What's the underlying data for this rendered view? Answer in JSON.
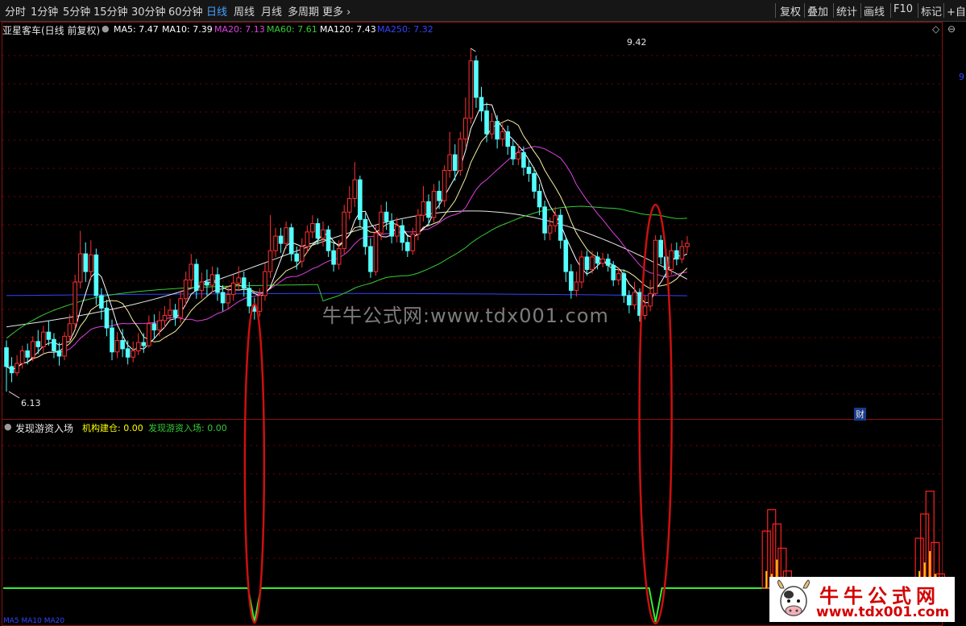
{
  "toolbar": {
    "periods": [
      "分时",
      "1分钟",
      "5分钟",
      "15分钟",
      "30分钟",
      "60分钟",
      "日线",
      "周线",
      "月线",
      "多周期",
      "更多 ›"
    ],
    "active": "日线",
    "right": [
      "复权",
      "叠加",
      "统计",
      "画线",
      "F10",
      "标记",
      "+自选"
    ]
  },
  "main": {
    "stock": "亚星客车(日线 前复权)",
    "ma": [
      {
        "label": "MA5: 7.47",
        "color": "#ffffff"
      },
      {
        "label": "MA10: 7.39",
        "color": "#ffffff"
      },
      {
        "label": "MA20: 7.13",
        "color": "#e040e0"
      },
      {
        "label": "MA60: 7.61",
        "color": "#33cc33"
      },
      {
        "label": "MA120: 7.43",
        "color": "#ffffff"
      },
      {
        "label": "MA250: 7.32",
        "color": "#3344ff"
      }
    ],
    "high_label": "9.42",
    "low_label": "6.13",
    "right_edge_label": "9",
    "fin_badge": "财",
    "watermark": "牛牛公式网:www.tdx001.com"
  },
  "sub": {
    "name": "发现游资入场",
    "values": [
      {
        "label": "机构建仓: 0.00",
        "color": "#ffff00"
      },
      {
        "label": "发现游资入场: 0.00",
        "color": "#33cc33"
      }
    ],
    "bottom_info": "MA5 MA10 MA20"
  },
  "brand": {
    "title": "牛牛公式网",
    "url": "www.tdx001.com"
  },
  "colors": {
    "up": "#ff3030",
    "down": "#54ffff",
    "ma5": "#ffffff",
    "ma10": "#f5f0a0",
    "ma20": "#e040e0",
    "ma60": "#33cc33",
    "ma120": "#e6e6e6",
    "ma250": "#3344ff",
    "grid": "#7a0000",
    "signal": "#33ee33",
    "bar_red": "#ff2020",
    "bar_yellow": "#ffd000"
  },
  "chart_data": {
    "type": "candlestick",
    "title": "亚星客车(日线 前复权)",
    "price_range": [
      6.13,
      9.42
    ],
    "candles": [
      [
        6.55,
        6.37,
        6.62,
        6.13
      ],
      [
        6.37,
        6.31,
        6.46,
        6.22
      ],
      [
        6.31,
        6.4,
        6.48,
        6.28
      ],
      [
        6.4,
        6.52,
        6.57,
        6.35
      ],
      [
        6.52,
        6.46,
        6.59,
        6.39
      ],
      [
        6.46,
        6.61,
        6.66,
        6.42
      ],
      [
        6.61,
        6.56,
        6.72,
        6.49
      ],
      [
        6.56,
        6.7,
        6.76,
        6.5
      ],
      [
        6.7,
        6.63,
        6.81,
        6.57
      ],
      [
        6.63,
        6.52,
        6.69,
        6.45
      ],
      [
        6.52,
        6.47,
        6.6,
        6.38
      ],
      [
        6.47,
        6.66,
        6.7,
        6.43
      ],
      [
        6.66,
        6.78,
        6.87,
        6.6
      ],
      [
        6.78,
        7.18,
        7.25,
        6.73
      ],
      [
        7.18,
        7.45,
        7.67,
        7.12
      ],
      [
        7.45,
        7.28,
        7.56,
        7.18
      ],
      [
        7.28,
        7.44,
        7.58,
        7.2
      ],
      [
        7.44,
        7.05,
        7.5,
        6.96
      ],
      [
        7.05,
        6.93,
        7.12,
        6.82
      ],
      [
        6.93,
        6.74,
        7.01,
        6.66
      ],
      [
        6.74,
        6.51,
        6.82,
        6.43
      ],
      [
        6.51,
        6.62,
        6.7,
        6.45
      ],
      [
        6.62,
        6.54,
        6.73,
        6.46
      ],
      [
        6.54,
        6.46,
        6.62,
        6.39
      ],
      [
        6.46,
        6.52,
        6.61,
        6.41
      ],
      [
        6.52,
        6.6,
        6.69,
        6.48
      ],
      [
        6.6,
        6.57,
        6.69,
        6.5
      ],
      [
        6.57,
        6.78,
        6.86,
        6.55
      ],
      [
        6.78,
        6.72,
        6.87,
        6.64
      ],
      [
        6.72,
        6.81,
        6.9,
        6.66
      ],
      [
        6.81,
        6.86,
        6.95,
        6.74
      ],
      [
        6.86,
        6.91,
        7.02,
        6.8
      ],
      [
        6.91,
        6.84,
        6.97,
        6.76
      ],
      [
        6.84,
        7.02,
        7.1,
        6.79
      ],
      [
        7.02,
        7.2,
        7.28,
        6.96
      ],
      [
        7.2,
        7.35,
        7.45,
        7.12
      ],
      [
        7.35,
        7.1,
        7.4,
        7.02
      ],
      [
        7.1,
        7.18,
        7.27,
        7.02
      ],
      [
        7.18,
        7.15,
        7.3,
        7.05
      ],
      [
        7.15,
        7.25,
        7.33,
        7.08
      ],
      [
        7.25,
        7.08,
        7.32,
        7.0
      ],
      [
        7.08,
        6.98,
        7.15,
        6.9
      ],
      [
        6.98,
        7.06,
        7.14,
        6.92
      ],
      [
        7.06,
        7.17,
        7.25,
        7.0
      ],
      [
        7.17,
        7.22,
        7.33,
        7.1
      ],
      [
        7.22,
        7.12,
        7.28,
        7.04
      ],
      [
        7.12,
        6.95,
        7.18,
        6.88
      ],
      [
        6.95,
        6.9,
        7.03,
        6.82
      ],
      [
        6.9,
        7.05,
        7.12,
        6.85
      ],
      [
        7.05,
        7.28,
        7.36,
        7.0
      ],
      [
        7.28,
        7.48,
        7.82,
        7.22
      ],
      [
        7.48,
        7.62,
        7.7,
        7.42
      ],
      [
        7.62,
        7.55,
        7.7,
        7.46
      ],
      [
        7.55,
        7.7,
        7.76,
        7.5
      ],
      [
        7.7,
        7.45,
        7.74,
        7.38
      ],
      [
        7.45,
        7.38,
        7.52,
        7.3
      ],
      [
        7.38,
        7.52,
        7.6,
        7.32
      ],
      [
        7.52,
        7.66,
        7.72,
        7.46
      ],
      [
        7.66,
        7.74,
        7.82,
        7.6
      ],
      [
        7.74,
        7.6,
        7.79,
        7.54
      ],
      [
        7.6,
        7.68,
        7.76,
        7.52
      ],
      [
        7.68,
        7.48,
        7.72,
        7.42
      ],
      [
        7.48,
        7.35,
        7.56,
        7.28
      ],
      [
        7.35,
        7.5,
        7.58,
        7.3
      ],
      [
        7.5,
        7.85,
        7.92,
        7.45
      ],
      [
        7.85,
        7.98,
        8.1,
        7.78
      ],
      [
        7.98,
        8.16,
        8.33,
        7.9
      ],
      [
        8.16,
        7.78,
        8.2,
        7.7
      ],
      [
        7.78,
        7.52,
        7.84,
        7.44
      ],
      [
        7.52,
        7.28,
        7.6,
        7.22
      ],
      [
        7.28,
        7.65,
        7.72,
        7.24
      ],
      [
        7.65,
        7.85,
        7.92,
        7.58
      ],
      [
        7.85,
        7.76,
        7.95,
        7.68
      ],
      [
        7.76,
        7.62,
        7.84,
        7.55
      ],
      [
        7.62,
        7.72,
        7.8,
        7.56
      ],
      [
        7.72,
        7.56,
        7.78,
        7.48
      ],
      [
        7.56,
        7.48,
        7.62,
        7.42
      ],
      [
        7.48,
        7.64,
        7.7,
        7.44
      ],
      [
        7.64,
        7.82,
        7.88,
        7.58
      ],
      [
        7.82,
        7.95,
        8.1,
        7.76
      ],
      [
        7.95,
        7.8,
        8.02,
        7.72
      ],
      [
        7.8,
        8.05,
        8.12,
        7.75
      ],
      [
        8.05,
        7.96,
        8.15,
        7.88
      ],
      [
        7.96,
        8.25,
        8.3,
        7.9
      ],
      [
        8.25,
        8.4,
        8.62,
        8.18
      ],
      [
        8.4,
        8.25,
        8.5,
        8.15
      ],
      [
        8.25,
        8.55,
        8.62,
        8.2
      ],
      [
        8.55,
        8.75,
        8.95,
        8.48
      ],
      [
        8.75,
        9.3,
        9.42,
        8.7
      ],
      [
        9.3,
        8.95,
        9.35,
        8.85
      ],
      [
        8.95,
        8.82,
        9.05,
        8.72
      ],
      [
        8.82,
        8.6,
        8.9,
        8.52
      ],
      [
        8.6,
        8.72,
        8.8,
        8.55
      ],
      [
        8.72,
        8.55,
        8.78,
        8.46
      ],
      [
        8.55,
        8.62,
        8.7,
        8.48
      ],
      [
        8.62,
        8.48,
        8.68,
        8.4
      ],
      [
        8.48,
        8.36,
        8.55,
        8.3
      ],
      [
        8.36,
        8.42,
        8.5,
        8.3
      ],
      [
        8.42,
        8.28,
        8.48,
        8.2
      ],
      [
        8.28,
        8.22,
        8.35,
        8.14
      ],
      [
        8.22,
        8.05,
        8.28,
        7.98
      ],
      [
        8.05,
        7.9,
        8.12,
        7.82
      ],
      [
        7.9,
        7.65,
        7.96,
        7.58
      ],
      [
        7.65,
        7.72,
        7.8,
        7.58
      ],
      [
        7.72,
        7.82,
        7.9,
        7.66
      ],
      [
        7.82,
        7.58,
        7.88,
        7.5
      ],
      [
        7.58,
        7.28,
        7.62,
        7.18
      ],
      [
        7.28,
        7.1,
        7.35,
        7.02
      ],
      [
        7.1,
        7.18,
        7.28,
        7.04
      ],
      [
        7.18,
        7.42,
        7.48,
        7.12
      ],
      [
        7.42,
        7.3,
        7.48,
        7.24
      ],
      [
        7.3,
        7.42,
        7.48,
        7.26
      ],
      [
        7.42,
        7.36,
        7.47,
        7.3
      ],
      [
        7.36,
        7.4,
        7.46,
        7.32
      ],
      [
        7.4,
        7.34,
        7.45,
        7.28
      ],
      [
        7.34,
        7.2,
        7.38,
        7.14
      ],
      [
        7.2,
        7.26,
        7.32,
        7.15
      ],
      [
        7.26,
        7.05,
        7.3,
        6.98
      ],
      [
        7.05,
        6.96,
        7.1,
        6.88
      ],
      [
        6.96,
        7.08,
        7.18,
        6.92
      ],
      [
        7.08,
        6.86,
        7.12,
        6.8
      ],
      [
        6.86,
        6.95,
        7.05,
        6.82
      ],
      [
        6.95,
        7.07,
        7.2,
        6.9
      ],
      [
        7.07,
        7.58,
        7.63,
        7.05
      ],
      [
        7.58,
        7.42,
        7.63,
        7.35
      ],
      [
        7.42,
        7.3,
        7.5,
        7.22
      ],
      [
        7.3,
        7.48,
        7.55,
        7.25
      ],
      [
        7.48,
        7.4,
        7.56,
        7.34
      ],
      [
        7.4,
        7.52,
        7.58,
        7.36
      ],
      [
        7.52,
        7.55,
        7.62,
        7.46
      ]
    ],
    "signal_dips": [
      47,
      123
    ],
    "signal_bars": [
      [
        {
          "i": 144,
          "red": 0.4,
          "yellow": 0.12
        },
        {
          "i": 145,
          "red": 0.55,
          "yellow": 0.1
        },
        {
          "i": 146,
          "red": 0.45,
          "yellow": 0.2
        },
        {
          "i": 147,
          "red": 0.28,
          "yellow": 0.08
        },
        {
          "i": 148,
          "red": 0.12,
          "yellow": 0.04
        }
      ],
      [
        {
          "i": 173,
          "red": 0.35,
          "yellow": 0.12
        },
        {
          "i": 174,
          "red": 0.52,
          "yellow": 0.18
        },
        {
          "i": 175,
          "red": 0.68,
          "yellow": 0.26
        },
        {
          "i": 176,
          "red": 0.32,
          "yellow": 0.1
        },
        {
          "i": 177,
          "red": 0.1,
          "yellow": 0.04
        }
      ]
    ]
  }
}
